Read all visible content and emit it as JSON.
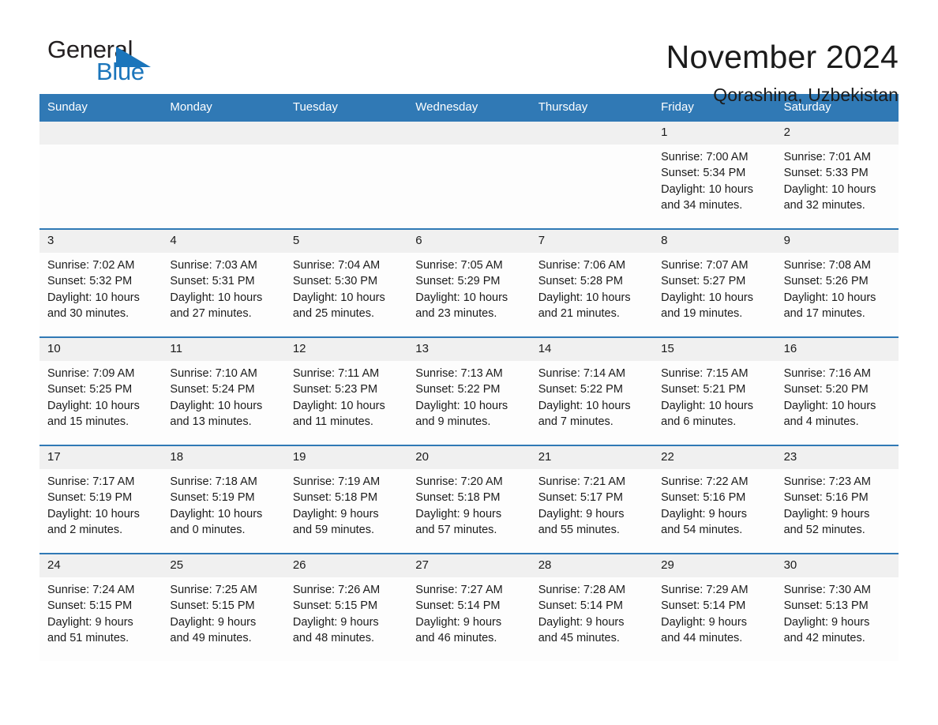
{
  "brand": {
    "name_part1": "General",
    "name_part2": "Blue",
    "accent_color": "#1b75bb"
  },
  "header": {
    "month_title": "November 2024",
    "location": "Qorashina, Uzbekistan"
  },
  "calendar": {
    "header_color": "#3079b5",
    "weekdays": [
      "Sunday",
      "Monday",
      "Tuesday",
      "Wednesday",
      "Thursday",
      "Friday",
      "Saturday"
    ],
    "weeks": [
      [
        {
          "day": "",
          "sunrise": "",
          "sunset": "",
          "daylight_line1": "",
          "daylight_line2": ""
        },
        {
          "day": "",
          "sunrise": "",
          "sunset": "",
          "daylight_line1": "",
          "daylight_line2": ""
        },
        {
          "day": "",
          "sunrise": "",
          "sunset": "",
          "daylight_line1": "",
          "daylight_line2": ""
        },
        {
          "day": "",
          "sunrise": "",
          "sunset": "",
          "daylight_line1": "",
          "daylight_line2": ""
        },
        {
          "day": "",
          "sunrise": "",
          "sunset": "",
          "daylight_line1": "",
          "daylight_line2": ""
        },
        {
          "day": "1",
          "sunrise": "Sunrise: 7:00 AM",
          "sunset": "Sunset: 5:34 PM",
          "daylight_line1": "Daylight: 10 hours",
          "daylight_line2": "and 34 minutes."
        },
        {
          "day": "2",
          "sunrise": "Sunrise: 7:01 AM",
          "sunset": "Sunset: 5:33 PM",
          "daylight_line1": "Daylight: 10 hours",
          "daylight_line2": "and 32 minutes."
        }
      ],
      [
        {
          "day": "3",
          "sunrise": "Sunrise: 7:02 AM",
          "sunset": "Sunset: 5:32 PM",
          "daylight_line1": "Daylight: 10 hours",
          "daylight_line2": "and 30 minutes."
        },
        {
          "day": "4",
          "sunrise": "Sunrise: 7:03 AM",
          "sunset": "Sunset: 5:31 PM",
          "daylight_line1": "Daylight: 10 hours",
          "daylight_line2": "and 27 minutes."
        },
        {
          "day": "5",
          "sunrise": "Sunrise: 7:04 AM",
          "sunset": "Sunset: 5:30 PM",
          "daylight_line1": "Daylight: 10 hours",
          "daylight_line2": "and 25 minutes."
        },
        {
          "day": "6",
          "sunrise": "Sunrise: 7:05 AM",
          "sunset": "Sunset: 5:29 PM",
          "daylight_line1": "Daylight: 10 hours",
          "daylight_line2": "and 23 minutes."
        },
        {
          "day": "7",
          "sunrise": "Sunrise: 7:06 AM",
          "sunset": "Sunset: 5:28 PM",
          "daylight_line1": "Daylight: 10 hours",
          "daylight_line2": "and 21 minutes."
        },
        {
          "day": "8",
          "sunrise": "Sunrise: 7:07 AM",
          "sunset": "Sunset: 5:27 PM",
          "daylight_line1": "Daylight: 10 hours",
          "daylight_line2": "and 19 minutes."
        },
        {
          "day": "9",
          "sunrise": "Sunrise: 7:08 AM",
          "sunset": "Sunset: 5:26 PM",
          "daylight_line1": "Daylight: 10 hours",
          "daylight_line2": "and 17 minutes."
        }
      ],
      [
        {
          "day": "10",
          "sunrise": "Sunrise: 7:09 AM",
          "sunset": "Sunset: 5:25 PM",
          "daylight_line1": "Daylight: 10 hours",
          "daylight_line2": "and 15 minutes."
        },
        {
          "day": "11",
          "sunrise": "Sunrise: 7:10 AM",
          "sunset": "Sunset: 5:24 PM",
          "daylight_line1": "Daylight: 10 hours",
          "daylight_line2": "and 13 minutes."
        },
        {
          "day": "12",
          "sunrise": "Sunrise: 7:11 AM",
          "sunset": "Sunset: 5:23 PM",
          "daylight_line1": "Daylight: 10 hours",
          "daylight_line2": "and 11 minutes."
        },
        {
          "day": "13",
          "sunrise": "Sunrise: 7:13 AM",
          "sunset": "Sunset: 5:22 PM",
          "daylight_line1": "Daylight: 10 hours",
          "daylight_line2": "and 9 minutes."
        },
        {
          "day": "14",
          "sunrise": "Sunrise: 7:14 AM",
          "sunset": "Sunset: 5:22 PM",
          "daylight_line1": "Daylight: 10 hours",
          "daylight_line2": "and 7 minutes."
        },
        {
          "day": "15",
          "sunrise": "Sunrise: 7:15 AM",
          "sunset": "Sunset: 5:21 PM",
          "daylight_line1": "Daylight: 10 hours",
          "daylight_line2": "and 6 minutes."
        },
        {
          "day": "16",
          "sunrise": "Sunrise: 7:16 AM",
          "sunset": "Sunset: 5:20 PM",
          "daylight_line1": "Daylight: 10 hours",
          "daylight_line2": "and 4 minutes."
        }
      ],
      [
        {
          "day": "17",
          "sunrise": "Sunrise: 7:17 AM",
          "sunset": "Sunset: 5:19 PM",
          "daylight_line1": "Daylight: 10 hours",
          "daylight_line2": "and 2 minutes."
        },
        {
          "day": "18",
          "sunrise": "Sunrise: 7:18 AM",
          "sunset": "Sunset: 5:19 PM",
          "daylight_line1": "Daylight: 10 hours",
          "daylight_line2": "and 0 minutes."
        },
        {
          "day": "19",
          "sunrise": "Sunrise: 7:19 AM",
          "sunset": "Sunset: 5:18 PM",
          "daylight_line1": "Daylight: 9 hours",
          "daylight_line2": "and 59 minutes."
        },
        {
          "day": "20",
          "sunrise": "Sunrise: 7:20 AM",
          "sunset": "Sunset: 5:18 PM",
          "daylight_line1": "Daylight: 9 hours",
          "daylight_line2": "and 57 minutes."
        },
        {
          "day": "21",
          "sunrise": "Sunrise: 7:21 AM",
          "sunset": "Sunset: 5:17 PM",
          "daylight_line1": "Daylight: 9 hours",
          "daylight_line2": "and 55 minutes."
        },
        {
          "day": "22",
          "sunrise": "Sunrise: 7:22 AM",
          "sunset": "Sunset: 5:16 PM",
          "daylight_line1": "Daylight: 9 hours",
          "daylight_line2": "and 54 minutes."
        },
        {
          "day": "23",
          "sunrise": "Sunrise: 7:23 AM",
          "sunset": "Sunset: 5:16 PM",
          "daylight_line1": "Daylight: 9 hours",
          "daylight_line2": "and 52 minutes."
        }
      ],
      [
        {
          "day": "24",
          "sunrise": "Sunrise: 7:24 AM",
          "sunset": "Sunset: 5:15 PM",
          "daylight_line1": "Daylight: 9 hours",
          "daylight_line2": "and 51 minutes."
        },
        {
          "day": "25",
          "sunrise": "Sunrise: 7:25 AM",
          "sunset": "Sunset: 5:15 PM",
          "daylight_line1": "Daylight: 9 hours",
          "daylight_line2": "and 49 minutes."
        },
        {
          "day": "26",
          "sunrise": "Sunrise: 7:26 AM",
          "sunset": "Sunset: 5:15 PM",
          "daylight_line1": "Daylight: 9 hours",
          "daylight_line2": "and 48 minutes."
        },
        {
          "day": "27",
          "sunrise": "Sunrise: 7:27 AM",
          "sunset": "Sunset: 5:14 PM",
          "daylight_line1": "Daylight: 9 hours",
          "daylight_line2": "and 46 minutes."
        },
        {
          "day": "28",
          "sunrise": "Sunrise: 7:28 AM",
          "sunset": "Sunset: 5:14 PM",
          "daylight_line1": "Daylight: 9 hours",
          "daylight_line2": "and 45 minutes."
        },
        {
          "day": "29",
          "sunrise": "Sunrise: 7:29 AM",
          "sunset": "Sunset: 5:14 PM",
          "daylight_line1": "Daylight: 9 hours",
          "daylight_line2": "and 44 minutes."
        },
        {
          "day": "30",
          "sunrise": "Sunrise: 7:30 AM",
          "sunset": "Sunset: 5:13 PM",
          "daylight_line1": "Daylight: 9 hours",
          "daylight_line2": "and 42 minutes."
        }
      ]
    ]
  }
}
